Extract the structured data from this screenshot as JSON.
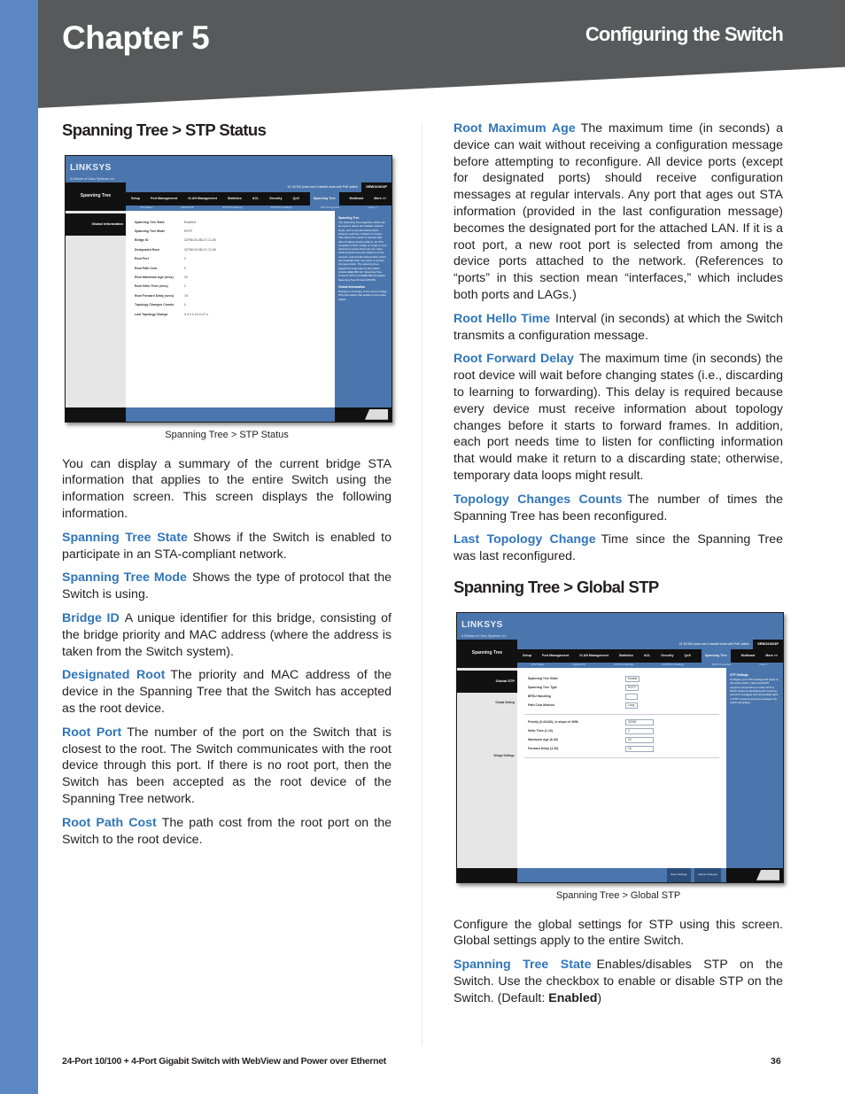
{
  "header": {
    "chapter": "Chapter 5",
    "section": "Configuring the Switch"
  },
  "left_column": {
    "heading": "Spanning Tree > STP Status",
    "screenshot": {
      "logo": "LINKSYS",
      "logo_sub": "A Division of Cisco Systems, Inc.",
      "page_name": "Spanning Tree",
      "info_text": "24 10/100 ports and 4 gigabit ports with PoE switch",
      "model": "SRW224G4P",
      "tabs": [
        "Setup",
        "Port Management",
        "VLAN Management",
        "Statistics",
        "ACL",
        "Security",
        "QoS",
        "Spanning Tree",
        "Multicast",
        "More >>"
      ],
      "active_tab": "Spanning Tree",
      "subtabs": [
        "STP Status",
        "Global STP",
        "STP Port Settings",
        "RSTP Port Settings",
        "MSTP Properties",
        "more >>"
      ],
      "side_label": "Global Information",
      "rows": [
        {
          "k": "Spanning Tree State",
          "v": "Enabled"
        },
        {
          "k": "Spanning Tree Mode",
          "v": "RSTP"
        },
        {
          "k": "Bridge ID",
          "v": "32768-00-0B-07-C1-60"
        },
        {
          "k": "Designated Root",
          "v": "32768-00-0B-07-C1-60"
        },
        {
          "k": "Root Port",
          "v": "0"
        },
        {
          "k": "Root Path Cost",
          "v": "0"
        },
        {
          "k": "Root Maximum Age (secs)",
          "v": "20"
        },
        {
          "k": "Root Hello Time (secs)",
          "v": "2"
        },
        {
          "k": "Root Forward Delay (secs)",
          "v": "15"
        },
        {
          "k": "Topology Changes Counts",
          "v": "0"
        },
        {
          "k": "Last Topology Change",
          "v": "0 d 0 h 10 m 47 s"
        }
      ],
      "help_title": "Spanning Tree",
      "help_text": "The Spanning Tree Algorithm (STA) can be used to detect and disable network loops, and to provide backup links between switches, bridges or routers. This allows the switch to interact with other bridging devices (that is, an STA-compliant switch, bridge or router) in your network to ensure that only one route exists between any two stations on the network, and provide backup links which automatically take over when a primary link goes down. The spanning tree algorithms supported by this switch include IEEE 802.1D, Spanning Tree Protocol (STP) and IEEE 802.1w Rapid Spanning Tree Protocol (RSTP).",
      "help_title2": "Global Information",
      "help_text2": "Displays a summary of the current bridge STA information that applies to the entire switch."
    },
    "caption": "Spanning Tree > STP Status",
    "intro": "You can display a summary of the current bridge STA information that applies to the entire Switch using the information screen. This screen displays the following information.",
    "definitions": [
      {
        "term": "Spanning Tree State",
        "text": "Shows if the Switch is enabled to participate in an STA-compliant network."
      },
      {
        "term": "Spanning Tree Mode",
        "text": "Shows the type of protocol that the Switch is using."
      },
      {
        "term": "Bridge ID",
        "text": "A unique identifier for this bridge, consisting of the bridge priority and MAC address (where the address is taken from the Switch system)."
      },
      {
        "term": "Designated Root",
        "text": "The priority and MAC address of the device in the Spanning Tree that the Switch has accepted as the root device."
      },
      {
        "term": "Root Port",
        "text": "The number of the port on the Switch that is closest to the root. The Switch communicates with the root device through this port. If there is no root port, then the Switch has been accepted as the root device of the Spanning Tree network."
      },
      {
        "term": "Root Path Cost",
        "text": "The path cost from the root port on the Switch to the root device."
      }
    ]
  },
  "right_column": {
    "definitions": [
      {
        "term": "Root Maximum Age",
        "text": "The maximum time (in seconds) a device can wait without receiving a configuration message before attempting to reconfigure. All device ports (except for designated ports) should receive configuration messages at regular intervals. Any port that ages out STA information (provided in the last configuration message) becomes the designated port for the attached LAN. If it is a root port, a new root port is selected from among the device ports attached to the network. (References to “ports” in this section mean “interfaces,” which includes both ports and LAGs.)"
      },
      {
        "term": "Root Hello Time",
        "text": "Interval (in seconds) at which the Switch transmits a configuration message."
      },
      {
        "term": "Root Forward Delay",
        "text": "The maximum time (in seconds) the root device will wait before changing states (i.e., discarding to learning to forwarding). This delay is required because every device must receive information about topology changes before it starts to forward frames. In addition, each port needs time to listen for conflicting information that would make it return to a discarding state; otherwise, temporary data loops might result."
      },
      {
        "term": "Topology Changes Counts",
        "text": "The number of times the Spanning Tree has been reconfigured."
      },
      {
        "term": "Last Topology Change",
        "text": "Time since the Spanning Tree was last reconfigured."
      }
    ],
    "heading": "Spanning Tree > Global STP",
    "screenshot": {
      "logo": "LINKSYS",
      "logo_sub": "A Division of Cisco Systems, Inc.",
      "page_name": "Spanning Tree",
      "info_text": "24 10/100 ports and 4 gigabit ports with PoE switch",
      "model": "SRW224G4P",
      "tabs": [
        "Setup",
        "Port Management",
        "VLAN Management",
        "Statistics",
        "ACL",
        "Security",
        "QoS",
        "Spanning Tree",
        "Multicast",
        "More >>"
      ],
      "active_tab": "Spanning Tree",
      "subtabs": [
        "STP Status",
        "Global STP",
        "STP Port Settings",
        "RSTP Port Settings",
        "MSTP Properties",
        "more >>"
      ],
      "side_label": "Global STP",
      "side_sub1": "Global Setting",
      "side_sub2": "Bridge Settings",
      "global_rows": [
        {
          "k": "Spanning Tree State",
          "v": "Enable"
        },
        {
          "k": "Spanning Tree Type",
          "v": "RSTP"
        },
        {
          "k": "BPDU Handling",
          "v": ""
        },
        {
          "k": "Path Cost Method",
          "v": "Long"
        }
      ],
      "bridge_rows": [
        {
          "k": "Priority (0-61440), in steps of 4096",
          "v": "32768"
        },
        {
          "k": "Hello Time (1-10)",
          "v": "2"
        },
        {
          "k": "Maximum Age (6-40)",
          "v": "20"
        },
        {
          "k": "Forward Delay (4-30)",
          "v": "15"
        }
      ],
      "help_title": "STP Settings",
      "help_text": "Configure your STP settings that apply to the entire switch. Note that RSTP supports connections to either STP or RSTP nodes by identifying the incoming protocol messages and shares/falls back to STP to look at protocol messages the switch accurately.",
      "save_label": "Save Settings",
      "cancel_label": "Cancel Changes"
    },
    "caption": "Spanning Tree > Global STP",
    "intro": "Configure the global settings for STP using this screen. Global settings apply to the entire Switch.",
    "state_term": "Spanning Tree State",
    "state_text": "Enables/disables STP on the Switch. Use the checkbox to enable or disable STP on the Switch. (Default: ",
    "state_default": "Enabled",
    "state_close": ")"
  },
  "footer": {
    "product": "24-Port 10/100 + 4-Port Gigabit Switch with WebView and Power over Ethernet",
    "page": "36"
  }
}
